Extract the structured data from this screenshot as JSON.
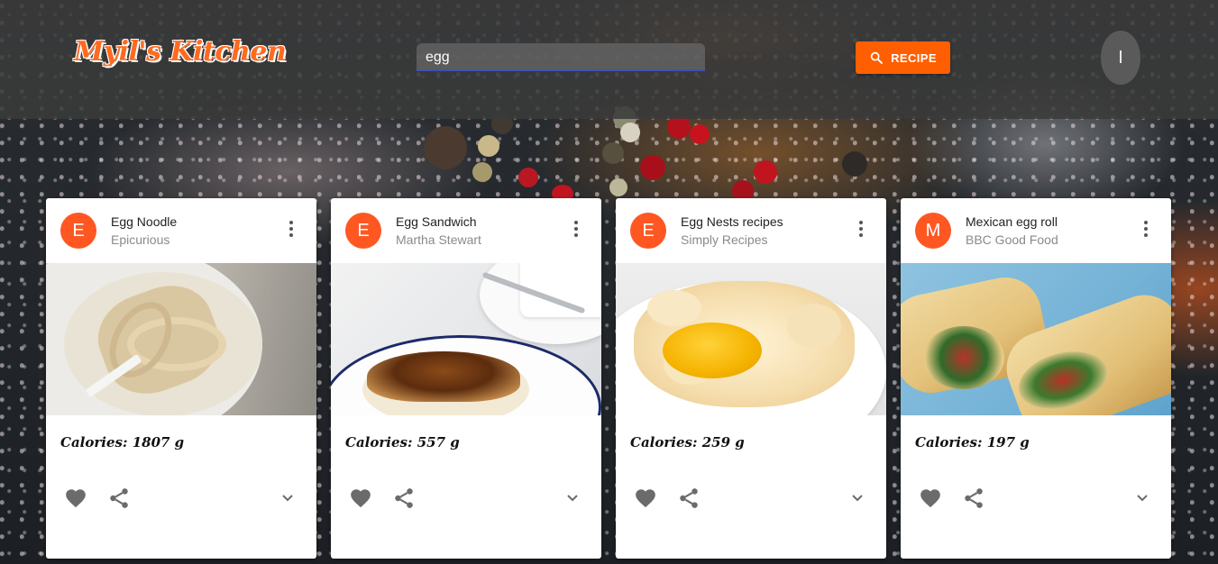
{
  "app": {
    "logo_text": "Myil's Kitchen",
    "search": {
      "value": "egg",
      "placeholder": ""
    },
    "search_button_label": "RECIPE",
    "user_initial": "I",
    "colors": {
      "accent": "#ff5f00",
      "avatar": "#ff5722",
      "header_bg": "#3a3a3a"
    }
  },
  "cards": [
    {
      "avatar": "E",
      "title": "Egg Noodle",
      "source": "Epicurious",
      "calories": "Calories: 1807 g",
      "image_icon": "egg-noodle-photo"
    },
    {
      "avatar": "E",
      "title": "Egg Sandwich",
      "source": "Martha Stewart",
      "calories": "Calories: 557 g",
      "image_icon": "egg-sandwich-photo"
    },
    {
      "avatar": "E",
      "title": "Egg Nests recipes",
      "source": "Simply Recipes",
      "calories": "Calories: 259 g",
      "image_icon": "egg-nest-photo"
    },
    {
      "avatar": "M",
      "title": "Mexican egg roll",
      "source": "BBC Good Food",
      "calories": "Calories: 197 g",
      "image_icon": "egg-roll-photo"
    }
  ],
  "icons": {
    "more": "more-vert-icon",
    "favorite": "favorite-icon",
    "share": "share-icon",
    "expand": "expand-more-icon",
    "search": "search-icon"
  }
}
